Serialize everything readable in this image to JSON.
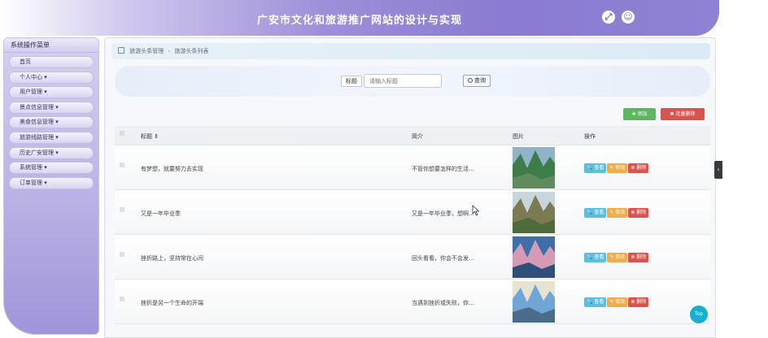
{
  "header": {
    "title": "广安市文化和旅游推广网站的设计与实现"
  },
  "sidebar": {
    "title": "系统操作菜单",
    "items": [
      {
        "label": "首页"
      },
      {
        "label": "个人中心 ▾"
      },
      {
        "label": "用户管理 ▾"
      },
      {
        "label": "景点信息管理 ▾"
      },
      {
        "label": "美食信息管理 ▾"
      },
      {
        "label": "旅游线路管理 ▾"
      },
      {
        "label": "历史广安管理 ▾"
      },
      {
        "label": "系统管理 ▾"
      },
      {
        "label": "订单管理 ▾"
      }
    ]
  },
  "breadcrumb": {
    "level1": "旅游头条管理",
    "separator": "›",
    "level2": "旅游头条列表"
  },
  "search": {
    "label": "标题",
    "placeholder": "请输入标题",
    "button": "查询"
  },
  "actions": {
    "add": "✚ 添加",
    "batch_delete": "✖ 批量删除"
  },
  "table": {
    "headers": {
      "title": "标题 ⇕",
      "intro": "简介",
      "picture": "图片",
      "ops": "操作"
    },
    "ops": {
      "view": "🔍 查看",
      "edit": "✎ 修改",
      "delete": "⊗ 删除"
    },
    "rows": [
      {
        "title": "有梦想，就要努力去实现",
        "intro": "不管你想要怎样的生活...",
        "pic_colors": [
          "#3d7d4a",
          "#8fb3c9",
          "#5f8b5e"
        ]
      },
      {
        "title": "又是一年毕业季",
        "intro": "又是一年毕业季，想啊...",
        "pic_colors": [
          "#7b7a52",
          "#c7d5dd",
          "#4f6a3b"
        ]
      },
      {
        "title": "挫折路上，坚持常在心间",
        "intro": "回头看看，你会不会发...",
        "pic_colors": [
          "#d59ab6",
          "#3f6fa8",
          "#2f4f7a"
        ]
      },
      {
        "title": "挫折是另一个生命的开端",
        "intro": "当遇到挫折或失败，你...",
        "pic_colors": [
          "#6fa6d6",
          "#e8e2d2",
          "#4a6b8a"
        ]
      }
    ]
  },
  "widgets": {
    "scroll_tab": "‹",
    "top": "Top"
  },
  "colors": {
    "accent": "#8a7bd0",
    "add": "#5cb85c",
    "delete": "#d9534f",
    "view": "#5bc0de",
    "edit": "#f0ad4e",
    "top": "#17b0cc"
  }
}
